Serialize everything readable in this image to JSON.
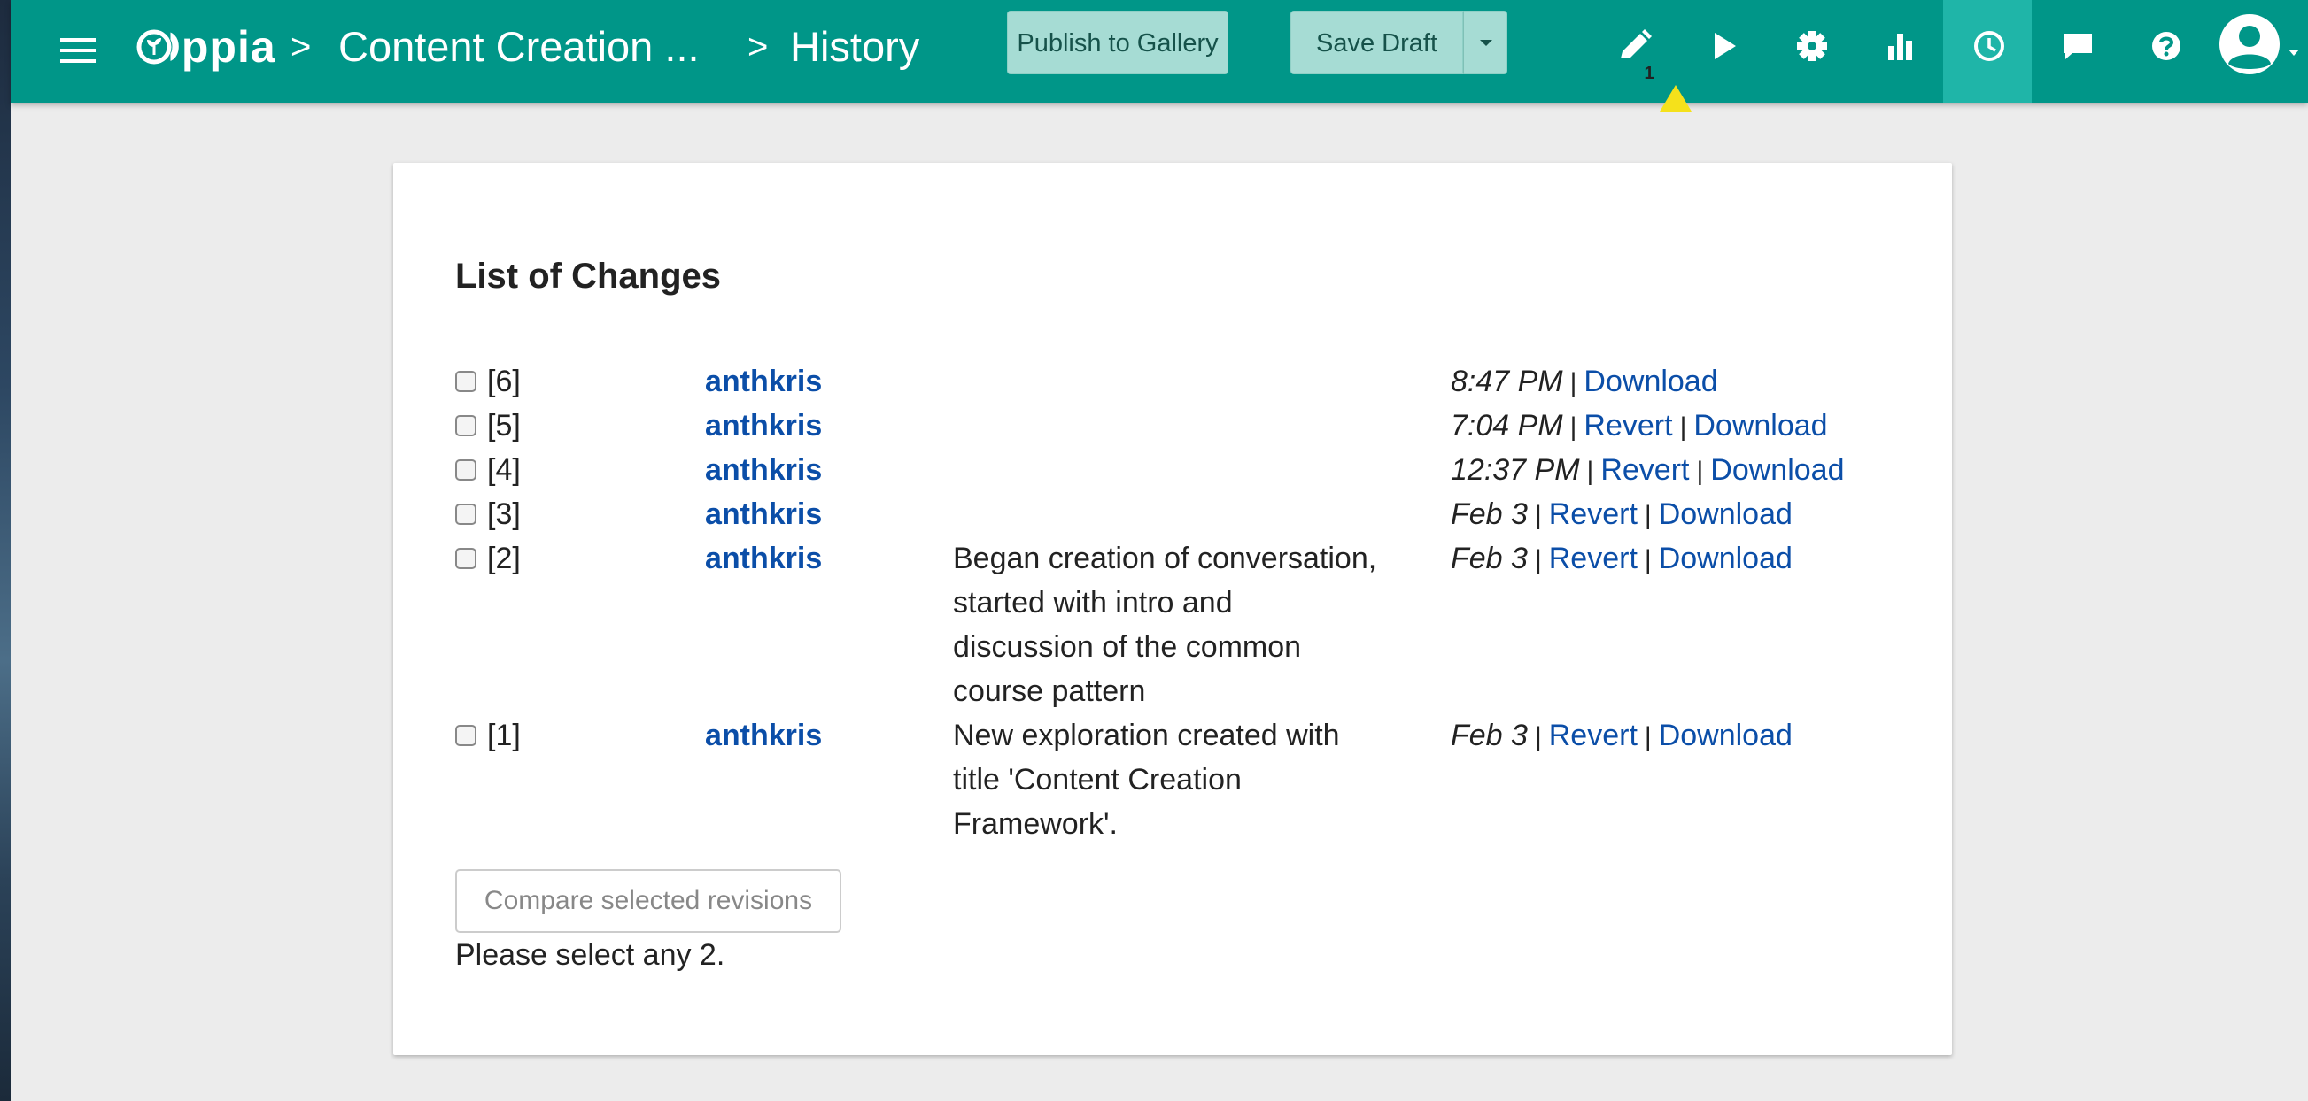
{
  "header": {
    "logo_text": "Oppia",
    "breadcrumb": [
      {
        "label": "Content Creation ..."
      },
      {
        "label": "History"
      }
    ],
    "breadcrumb_separator": ">",
    "publish_label": "Publish to Gallery",
    "save_draft_label": "Save Draft",
    "warning_count": "1",
    "nav_icons": [
      "pencil-icon",
      "play-icon",
      "gear-icon",
      "bar-chart-icon",
      "clock-icon",
      "chat-icon",
      "help-icon"
    ],
    "active_nav": "clock-icon",
    "colors": {
      "bar": "#009688",
      "active": "#1fb5a8",
      "button": "#a6dcd4",
      "warning": "#f5e11b"
    }
  },
  "history": {
    "title": "List of Changes",
    "separator": "|",
    "revisions": [
      {
        "version": "[6]",
        "user": "anthkris",
        "message": [],
        "date": "8:47 PM",
        "revert": "",
        "download": "Download"
      },
      {
        "version": "[5]",
        "user": "anthkris",
        "message": [],
        "date": "7:04 PM",
        "revert": "Revert",
        "download": "Download"
      },
      {
        "version": "[4]",
        "user": "anthkris",
        "message": [],
        "date": "12:37 PM",
        "revert": "Revert",
        "download": "Download"
      },
      {
        "version": "[3]",
        "user": "anthkris",
        "message": [],
        "date": "Feb 3",
        "revert": "Revert",
        "download": "Download"
      },
      {
        "version": "[2]",
        "user": "anthkris",
        "message": [
          "Began creation of conversation,",
          "started with intro and",
          "discussion of the common",
          "course pattern"
        ],
        "date": "Feb 3",
        "revert": "Revert",
        "download": "Download"
      },
      {
        "version": "[1]",
        "user": "anthkris",
        "message": [
          "New exploration created with",
          "title 'Content Creation",
          "Framework'."
        ],
        "date": "Feb 3",
        "revert": "Revert",
        "download": "Download"
      }
    ],
    "compare_label": "Compare selected revisions",
    "hint": "Please select any 2.",
    "link_color": "#0b4ea8"
  }
}
